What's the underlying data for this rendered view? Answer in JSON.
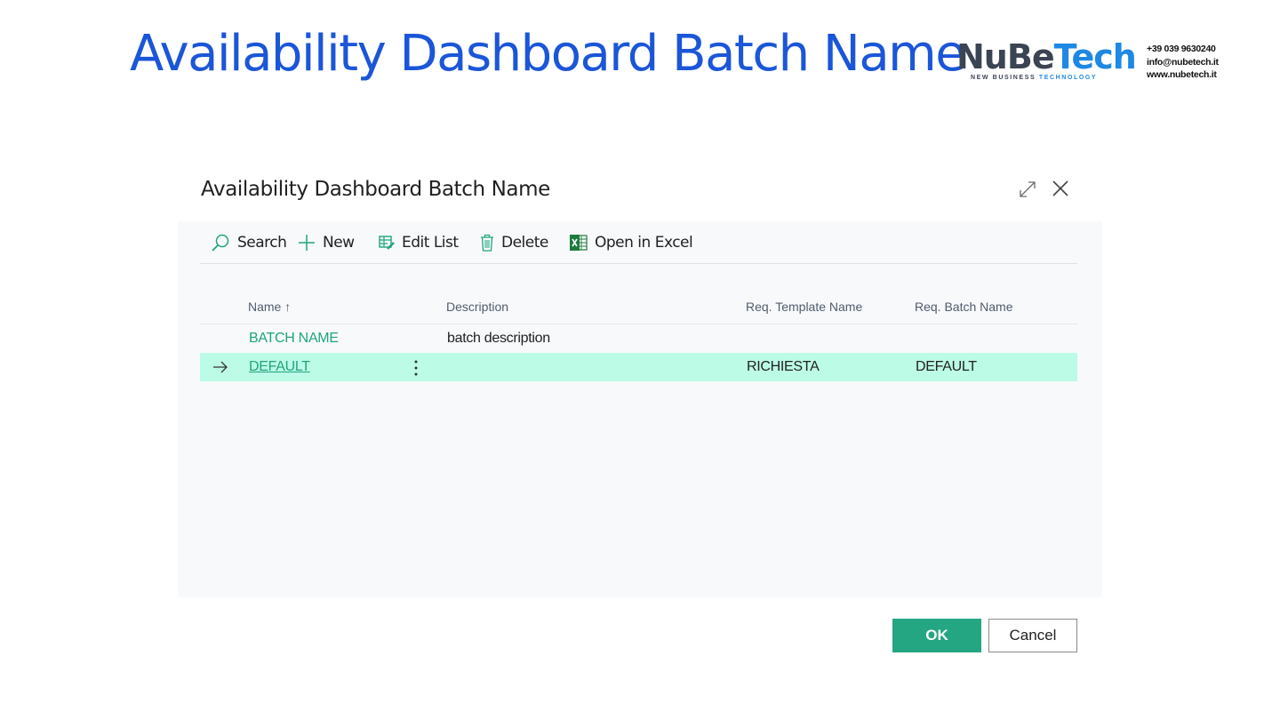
{
  "slide": {
    "title": "Availability Dashboard Batch Name"
  },
  "logo": {
    "part1": "NuBe",
    "part2": "Tech",
    "tagline_part1": "NEW BUSINESS",
    "tagline_part2": "TECHNOLOGY"
  },
  "contact": {
    "phone": "+39 039 9630240",
    "email": "info@nubetech.it",
    "website": "www.nubetech.it"
  },
  "dialog": {
    "title": "Availability Dashboard Batch Name",
    "toolbar": {
      "search": "Search",
      "new": "New",
      "edit_list": "Edit List",
      "delete": "Delete",
      "open_excel": "Open in Excel"
    },
    "columns": {
      "name": "Name",
      "description": "Description",
      "req_template": "Req. Template Name",
      "req_batch": "Req. Batch Name"
    },
    "rows": [
      {
        "name": "BATCH NAME",
        "description": "batch description",
        "req_template": "",
        "req_batch": ""
      },
      {
        "name": "DEFAULT",
        "description": "",
        "req_template": "RICHIESTA",
        "req_batch": "DEFAULT"
      }
    ],
    "buttons": {
      "ok": "OK",
      "cancel": "Cancel"
    }
  },
  "colors": {
    "title_blue": "#1b56d9",
    "accent_green": "#25a683",
    "selected_row": "#bcfbe6",
    "link_green": "#1fa57e"
  }
}
